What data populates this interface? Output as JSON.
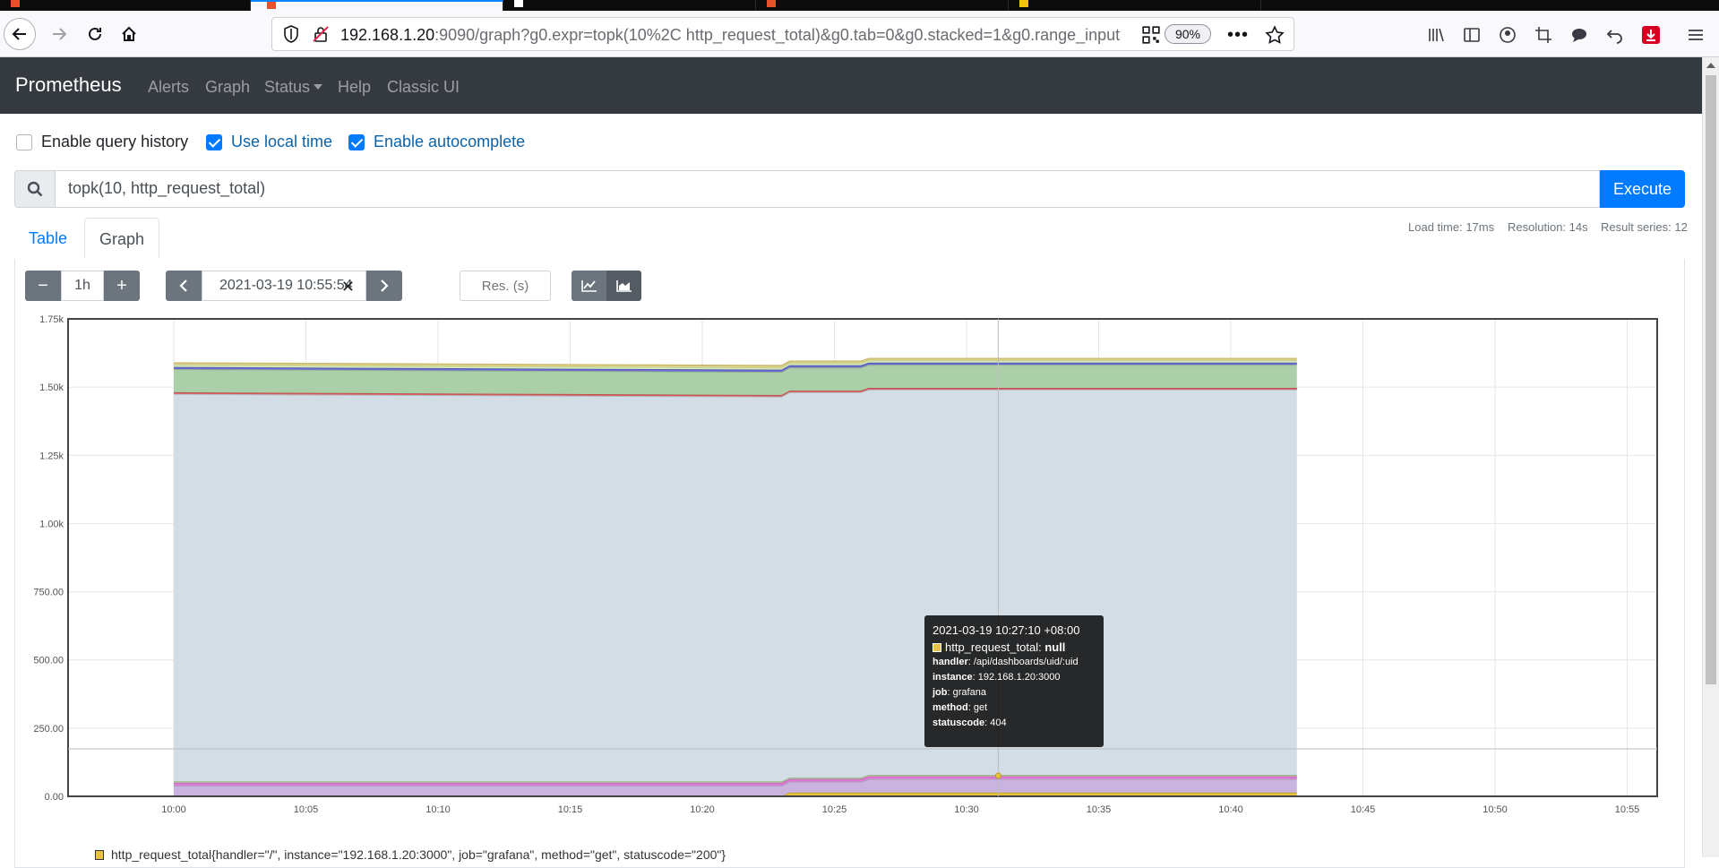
{
  "browser": {
    "url_host": "192.168.1.20",
    "url_rest": ":9090/graph?g0.expr=topk(10%2C http_request_total)&g0.tab=0&g0.stacked=1&g0.range_input",
    "zoom": "90%"
  },
  "navbar": {
    "brand": "Prometheus",
    "links": [
      "Alerts",
      "Graph",
      "Status",
      "Help",
      "Classic UI"
    ]
  },
  "options": {
    "query_history": {
      "label": "Enable query history",
      "checked": false
    },
    "local_time": {
      "label": "Use local time",
      "checked": true
    },
    "autocomplete": {
      "label": "Enable autocomplete",
      "checked": true
    }
  },
  "query": {
    "expression": "topk(10, http_request_total)",
    "execute_label": "Execute"
  },
  "tabs": [
    "Table",
    "Graph"
  ],
  "stats": {
    "load_time": "Load time: 17ms",
    "resolution": "Resolution: 14s",
    "result_series": "Result series: 12"
  },
  "graph_controls": {
    "range": "1h",
    "end_time": "2021-03-19 10:55:54",
    "resolution_placeholder": "Res. (s)"
  },
  "chart_data": {
    "type": "area",
    "stacked": true,
    "x_ticks": [
      "10:00",
      "10:05",
      "10:10",
      "10:15",
      "10:20",
      "10:25",
      "10:30",
      "10:35",
      "10:40",
      "10:45",
      "10:50",
      "10:55"
    ],
    "y_ticks": [
      "0.00",
      "250.00",
      "500.00",
      "750.00",
      "1.00k",
      "1.25k",
      "1.50k",
      "1.75k"
    ],
    "ylim": [
      0,
      1750
    ],
    "x_minutes": [
      0,
      23,
      23.3,
      26,
      26.3,
      42.5
    ],
    "series": [
      {
        "color": "#e6c23d",
        "values": [
          0,
          0,
          14,
          14,
          14,
          14
        ]
      },
      {
        "color": "#c9b4e0",
        "values": [
          40,
          40,
          40,
          40,
          50,
          50
        ]
      },
      {
        "color": "#e07cd7",
        "values": [
          10,
          10,
          10,
          10,
          10,
          10
        ]
      },
      {
        "color": "#bfd8a6",
        "values": [
          5,
          5,
          5,
          5,
          5,
          5
        ]
      },
      {
        "color": "#d2dde6",
        "values": [
          1420,
          1410,
          1412,
          1412,
          1412,
          1412
        ]
      },
      {
        "color": "#e05f5f",
        "values": [
          6,
          6,
          6,
          6,
          6,
          6
        ]
      },
      {
        "color": "#abcfa9",
        "values": [
          85,
          85,
          85,
          85,
          85,
          85
        ]
      },
      {
        "color": "#6b6bd6",
        "values": [
          8,
          8,
          8,
          8,
          8,
          8
        ]
      },
      {
        "color": "#d9f0b8",
        "values": [
          8,
          8,
          8,
          8,
          8,
          8
        ]
      },
      {
        "color": "#f0e08a",
        "values": [
          6,
          6,
          6,
          6,
          6,
          6
        ]
      }
    ]
  },
  "tooltip": {
    "time": "2021-03-19 10:27:10 +08:00",
    "metric": "http_request_total",
    "value": "null",
    "labels": [
      {
        "key": "handler",
        "value": "/api/dashboards/uid/:uid"
      },
      {
        "key": "instance",
        "value": "192.168.1.20:3000"
      },
      {
        "key": "job",
        "value": "grafana"
      },
      {
        "key": "method",
        "value": "get"
      },
      {
        "key": "statuscode",
        "value": "404"
      }
    ]
  },
  "legend": {
    "first_entry": "http_request_total{handler=\"/\", instance=\"192.168.1.20:3000\", job=\"grafana\", method=\"get\", statuscode=\"200\"}"
  }
}
